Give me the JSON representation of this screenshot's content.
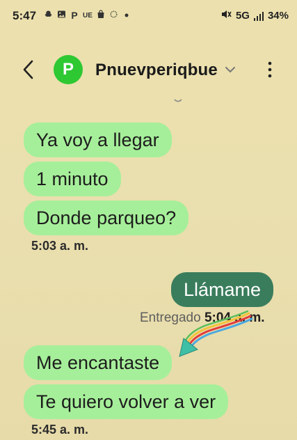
{
  "status_bar": {
    "time": "5:47",
    "left_icons": [
      "snapchat-icon",
      "photo-icon",
      "p-icon",
      "ue-icon",
      "shop-icon",
      "sun-icon",
      "dot-icon"
    ],
    "ue_text": "UE",
    "p_text": "P",
    "network": "5G",
    "battery": "34%"
  },
  "header": {
    "avatar_letter": "P",
    "avatar_color": "#2ec832",
    "contact_name": "Pnuevperiqbue"
  },
  "messages": [
    {
      "direction": "in",
      "text": "Ya voy a llegar"
    },
    {
      "direction": "in",
      "text": "1 minuto"
    },
    {
      "direction": "in",
      "text": "Donde parqueo?"
    },
    {
      "direction": "in",
      "time": "5:03 a. m."
    },
    {
      "direction": "out",
      "text": "Llámame"
    },
    {
      "direction": "out",
      "status": "Entregado",
      "time": "5:04 a. m."
    },
    {
      "direction": "in",
      "text": "Me encantaste"
    },
    {
      "direction": "in",
      "text": "Te quiero volver a ver"
    },
    {
      "direction": "in",
      "time": "5:45 a. m."
    }
  ],
  "colors": {
    "incoming_bubble": "#a6ef9a",
    "outgoing_bubble": "#3a7d5c",
    "background": "#ece1ae"
  }
}
